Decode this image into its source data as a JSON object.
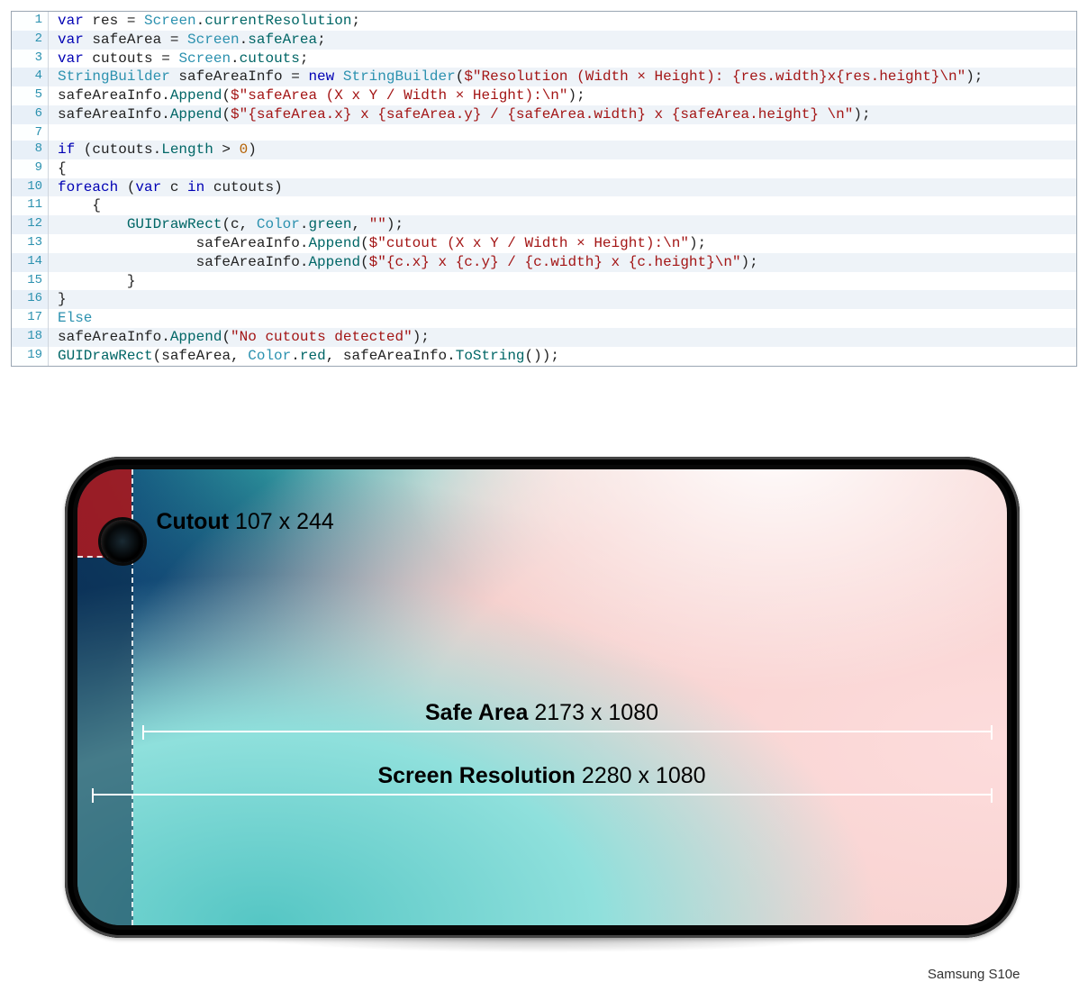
{
  "code": {
    "lines": [
      {
        "n": 1,
        "stripe": false,
        "tokens": [
          {
            "c": "kw",
            "t": "var"
          },
          {
            "t": " res "
          },
          {
            "c": "",
            "t": "= "
          },
          {
            "c": "type",
            "t": "Screen"
          },
          {
            "t": "."
          },
          {
            "c": "alt",
            "t": "currentResolution"
          },
          {
            "t": ";"
          }
        ]
      },
      {
        "n": 2,
        "stripe": true,
        "tokens": [
          {
            "c": "kw",
            "t": "var"
          },
          {
            "t": " safeArea = "
          },
          {
            "c": "type",
            "t": "Screen"
          },
          {
            "t": "."
          },
          {
            "c": "alt",
            "t": "safeArea"
          },
          {
            "t": ";"
          }
        ]
      },
      {
        "n": 3,
        "stripe": false,
        "tokens": [
          {
            "c": "kw",
            "t": "var"
          },
          {
            "t": " cutouts = "
          },
          {
            "c": "type",
            "t": "Screen"
          },
          {
            "t": "."
          },
          {
            "c": "alt",
            "t": "cutouts"
          },
          {
            "t": ";"
          }
        ]
      },
      {
        "n": 4,
        "stripe": true,
        "tokens": [
          {
            "c": "type",
            "t": "StringBuilder"
          },
          {
            "t": " safeAreaInfo = "
          },
          {
            "c": "kw",
            "t": "new"
          },
          {
            "t": " "
          },
          {
            "c": "type",
            "t": "StringBuilder"
          },
          {
            "t": "("
          },
          {
            "c": "str",
            "t": "$\"Resolution (Width × Height): {res.width}x{res.height}\\n\""
          },
          {
            "t": ");"
          }
        ]
      },
      {
        "n": 5,
        "stripe": false,
        "tokens": [
          {
            "t": "safeAreaInfo."
          },
          {
            "c": "alt",
            "t": "Append"
          },
          {
            "t": "("
          },
          {
            "c": "str",
            "t": "$\"safeArea (X x Y / Width × Height):\\n\""
          },
          {
            "t": ");"
          }
        ]
      },
      {
        "n": 6,
        "stripe": true,
        "tokens": [
          {
            "t": "safeAreaInfo."
          },
          {
            "c": "alt",
            "t": "Append"
          },
          {
            "t": "("
          },
          {
            "c": "str",
            "t": "$\"{safeArea.x} x {safeArea.y} / {safeArea.width} x {safeArea.height} \\n\""
          },
          {
            "t": ");"
          }
        ]
      },
      {
        "n": 7,
        "stripe": false,
        "tokens": [
          {
            "t": ""
          }
        ]
      },
      {
        "n": 8,
        "stripe": true,
        "tokens": [
          {
            "c": "kw",
            "t": "if"
          },
          {
            "t": " (cutouts."
          },
          {
            "c": "alt",
            "t": "Length"
          },
          {
            "t": " > "
          },
          {
            "c": "num",
            "t": "0"
          },
          {
            "t": ")"
          }
        ]
      },
      {
        "n": 9,
        "stripe": false,
        "tokens": [
          {
            "t": "{"
          }
        ]
      },
      {
        "n": 10,
        "stripe": true,
        "tokens": [
          {
            "c": "kw",
            "t": "foreach"
          },
          {
            "t": " ("
          },
          {
            "c": "kw",
            "t": "var"
          },
          {
            "t": " c "
          },
          {
            "c": "kw",
            "t": "in"
          },
          {
            "t": " cutouts)"
          }
        ]
      },
      {
        "n": 11,
        "stripe": false,
        "tokens": [
          {
            "t": "    {"
          }
        ]
      },
      {
        "n": 12,
        "stripe": true,
        "tokens": [
          {
            "t": "        "
          },
          {
            "c": "alt",
            "t": "GUIDrawRect"
          },
          {
            "t": "(c, "
          },
          {
            "c": "type",
            "t": "Color"
          },
          {
            "t": "."
          },
          {
            "c": "alt",
            "t": "green"
          },
          {
            "t": ", "
          },
          {
            "c": "str",
            "t": "\"\""
          },
          {
            "t": ");"
          }
        ]
      },
      {
        "n": 13,
        "stripe": false,
        "tokens": [
          {
            "t": "                safeAreaInfo."
          },
          {
            "c": "alt",
            "t": "Append"
          },
          {
            "t": "("
          },
          {
            "c": "str",
            "t": "$\"cutout (X x Y / Width × Height):\\n\""
          },
          {
            "t": ");"
          }
        ]
      },
      {
        "n": 14,
        "stripe": true,
        "tokens": [
          {
            "t": "                safeAreaInfo."
          },
          {
            "c": "alt",
            "t": "Append"
          },
          {
            "t": "("
          },
          {
            "c": "str",
            "t": "$\"{c.x} x {c.y} / {c.width} x {c.height}\\n\""
          },
          {
            "t": ");"
          }
        ]
      },
      {
        "n": 15,
        "stripe": false,
        "tokens": [
          {
            "t": "        }"
          }
        ]
      },
      {
        "n": 16,
        "stripe": true,
        "tokens": [
          {
            "t": "}"
          }
        ]
      },
      {
        "n": 17,
        "stripe": false,
        "tokens": [
          {
            "c": "type",
            "t": "Else"
          }
        ]
      },
      {
        "n": 18,
        "stripe": true,
        "tokens": [
          {
            "t": "safeAreaInfo."
          },
          {
            "c": "alt",
            "t": "Append"
          },
          {
            "t": "("
          },
          {
            "c": "str",
            "t": "\"No cutouts detected\""
          },
          {
            "t": ");"
          }
        ]
      },
      {
        "n": 19,
        "stripe": false,
        "tokens": [
          {
            "c": "alt",
            "t": "GUIDrawRect"
          },
          {
            "t": "(safeArea, "
          },
          {
            "c": "type",
            "t": "Color"
          },
          {
            "t": "."
          },
          {
            "c": "alt",
            "t": "red"
          },
          {
            "t": ", safeAreaInfo."
          },
          {
            "c": "alt",
            "t": "ToString"
          },
          {
            "t": "());"
          }
        ]
      }
    ]
  },
  "phone": {
    "cutout_label_prefix": "Cutout",
    "cutout_value": "107 x 244",
    "safearea_label_prefix": "Safe Area",
    "safearea_value": "2173 x 1080",
    "resolution_label_prefix": "Screen Resolution",
    "resolution_value": "2280 x 1080",
    "caption": "Samsung S10e"
  }
}
